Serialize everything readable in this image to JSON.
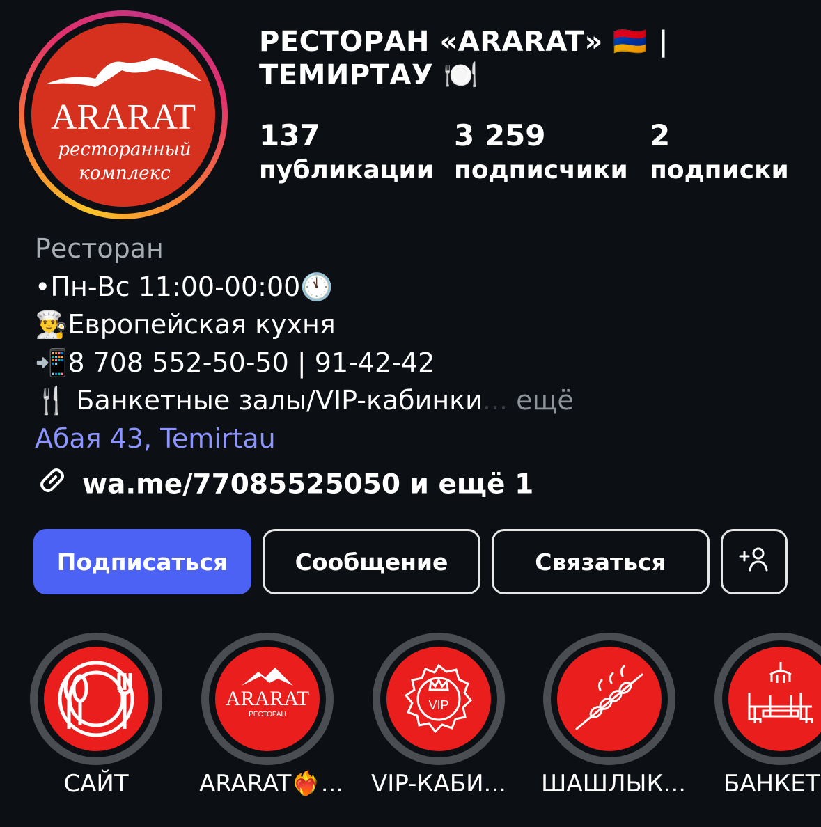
{
  "profile": {
    "name_line1": "РЕСТОРАН «ARARAT» 🇦🇲 |",
    "name_line2": "ТЕМИРТАУ 🍽️",
    "avatar_text": "ARARAT",
    "avatar_sub1": "ресторанный",
    "avatar_sub2": "комплекс",
    "stats": [
      {
        "value": "137",
        "label": "публикации"
      },
      {
        "value": "3 259",
        "label": "подписчики"
      },
      {
        "value": "2",
        "label": "подписки"
      }
    ]
  },
  "bio": {
    "category": "Ресторан",
    "line1": "•Пн-Вс 11:00-00:00🕚",
    "line2": "👨‍🍳Европейская кухня",
    "line3": "📲8 708 552-50-50 | 91-42-42",
    "line4": "🍴 Банкетные залы/VIP-кабинки",
    "line4_dots": "...",
    "more": " ещё",
    "address": "Абая 43, Temirtau"
  },
  "link": {
    "text": "wa.me/77085525050 и ещё 1",
    "icon": "link-icon"
  },
  "buttons": {
    "follow": "Подписаться",
    "message": "Сообщение",
    "contact": "Связаться",
    "add_person_icon": "add-person-icon"
  },
  "highlights": [
    {
      "label": "САЙТ",
      "icon": "plate-cutlery-icon"
    },
    {
      "label": "ARARAT❤️‍🔥...",
      "icon": "ararat-logo-icon",
      "logo_text": "ARARAT",
      "logo_sub": "РЕСТОРАН"
    },
    {
      "label": "VIP-КАБИ...",
      "icon": "vip-crown-badge-icon",
      "badge_text": "VIP"
    },
    {
      "label": "ШАШЛЫК...",
      "icon": "skewer-icon"
    },
    {
      "label": "БАНКЕТН",
      "icon": "banquet-table-icon"
    }
  ],
  "colors": {
    "background": "#0c0f14",
    "follow_button": "#4c62f5",
    "link_blue": "#8c95ff",
    "highlight_red": "#ea1f1d",
    "avatar_red": "#d6311f"
  }
}
